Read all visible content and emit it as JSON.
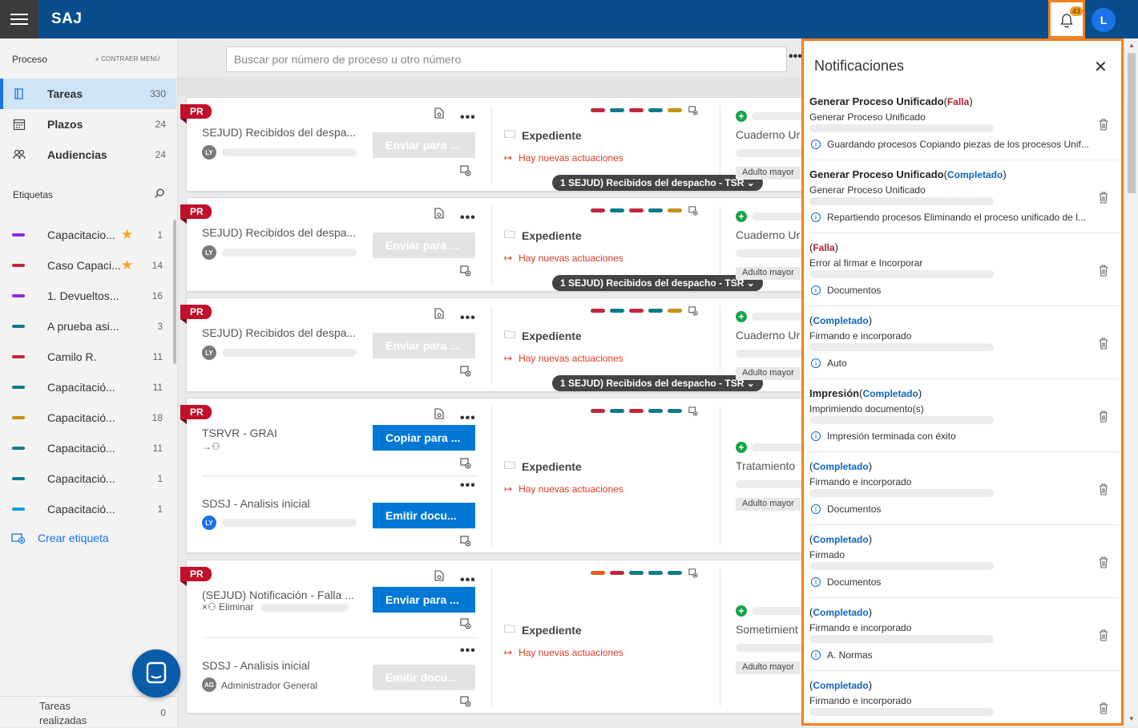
{
  "app": {
    "title": "SAJ",
    "bell_count": "43",
    "avatar": "L"
  },
  "sidebar": {
    "header": "Proceso",
    "collapse": "« CONTRAER MENÚ",
    "nav": [
      {
        "label": "Tareas",
        "count": "330",
        "icon": "book-icon"
      },
      {
        "label": "Plazos",
        "count": "24",
        "icon": "calendar-icon"
      },
      {
        "label": "Audiencias",
        "count": "24",
        "icon": "people-icon"
      }
    ],
    "labels_header": "Etiquetas",
    "labels": [
      {
        "label": "Capacitacio...",
        "count": "1",
        "color": "#8a2be2",
        "star": true
      },
      {
        "label": "Caso Capaci...",
        "count": "14",
        "color": "#c0283c",
        "star": true
      },
      {
        "label": "1. Devueltos...",
        "count": "16",
        "color": "#8a2be2",
        "star": false
      },
      {
        "label": "A prueba asi...",
        "count": "3",
        "color": "#0f7b8a",
        "star": false
      },
      {
        "label": "Camilo R.",
        "count": "11",
        "color": "#c0283c",
        "star": false
      },
      {
        "label": "Capacitació...",
        "count": "11",
        "color": "#0f7b8a",
        "star": false
      },
      {
        "label": "Capacitació...",
        "count": "18",
        "color": "#c8901a",
        "star": false
      },
      {
        "label": "Capacitació...",
        "count": "11",
        "color": "#0f7b8a",
        "star": false
      },
      {
        "label": "Capacitació...",
        "count": "1",
        "color": "#0f7b8a",
        "star": false
      },
      {
        "label": "Capacitació...",
        "count": "1",
        "color": "#1a9ad6",
        "star": false
      }
    ],
    "create_label": "Crear etiqueta",
    "done_label": "Tareas realizadas",
    "done_count": "0"
  },
  "search": {
    "placeholder": "Buscar por número de proceso u otro número"
  },
  "common": {
    "pr": "PR",
    "expediente": "Expediente",
    "news": "Hay nuevas actuaciones",
    "pill": "1 SEJUD) Recibidos del despacho - TSR",
    "adult": "Adulto mayor"
  },
  "cards": [
    {
      "title": "SEJUD) Recibidos del despa...",
      "av": "LY",
      "button": "Enviar para ...",
      "cuaderno": "Cuaderno Ur"
    },
    {
      "title": "SEJUD) Recibidos del despa...",
      "av": "LY",
      "button": "Enviar para ...",
      "cuaderno": "Cuaderno Ur"
    },
    {
      "title": "SEJUD) Recibidos del despa...",
      "av": "LY",
      "button": "Enviar para ...",
      "cuaderno": "Cuaderno Ur"
    },
    {
      "title": "TSRVR - GRAI",
      "button": "Copiar para ...",
      "title2": "SDSJ - Analisis inicial",
      "av2": "LY",
      "button2": "Emitir docu...",
      "cuaderno": "Tratamiento"
    },
    {
      "title": "(SEJUD) Notificación - Falla ...",
      "sub": "Eliminar",
      "button": "Enviar para ...",
      "title2": "SDSJ - Analisis inicial",
      "av2": "AG",
      "sub2": "Administrador General",
      "button2": "Emitir docu...",
      "cuaderno": "Sometimient"
    }
  ],
  "notifications": {
    "title": "Notificaciones",
    "items": [
      {
        "head": "Generar Proceso Unificado",
        "status": "Falla",
        "sub": "Generar Proceso Unificado",
        "info": "Guardando procesos Copiando piezas de los procesos Unif..."
      },
      {
        "head": "Generar Proceso Unificado",
        "status": "Completado",
        "sub": "Generar Proceso Unificado",
        "info": "Repartiendo procesos Eliminando el proceso unificado de l..."
      },
      {
        "head": "",
        "status": "Falla",
        "sub": "Error al firmar e Incorporar",
        "info": "Documentos"
      },
      {
        "head": "",
        "status": "Completado",
        "sub": "Firmando e incorporado",
        "info": "Auto"
      },
      {
        "head": "Impresión",
        "status": "Completado",
        "sub": "Imprimiendo documento(s)",
        "info": "Impresión terminada con éxito"
      },
      {
        "head": "",
        "status": "Completado",
        "sub": "Firmando e incorporado",
        "info": "Documentos"
      },
      {
        "head": "",
        "status": "Completado",
        "sub": "Firmado",
        "info": "Documentos"
      },
      {
        "head": "",
        "status": "Completado",
        "sub": "Firmando e incorporado",
        "info": "A. Normas"
      },
      {
        "head": "",
        "status": "Completado",
        "sub": "Firmando e incorporado",
        "info": ""
      }
    ]
  }
}
